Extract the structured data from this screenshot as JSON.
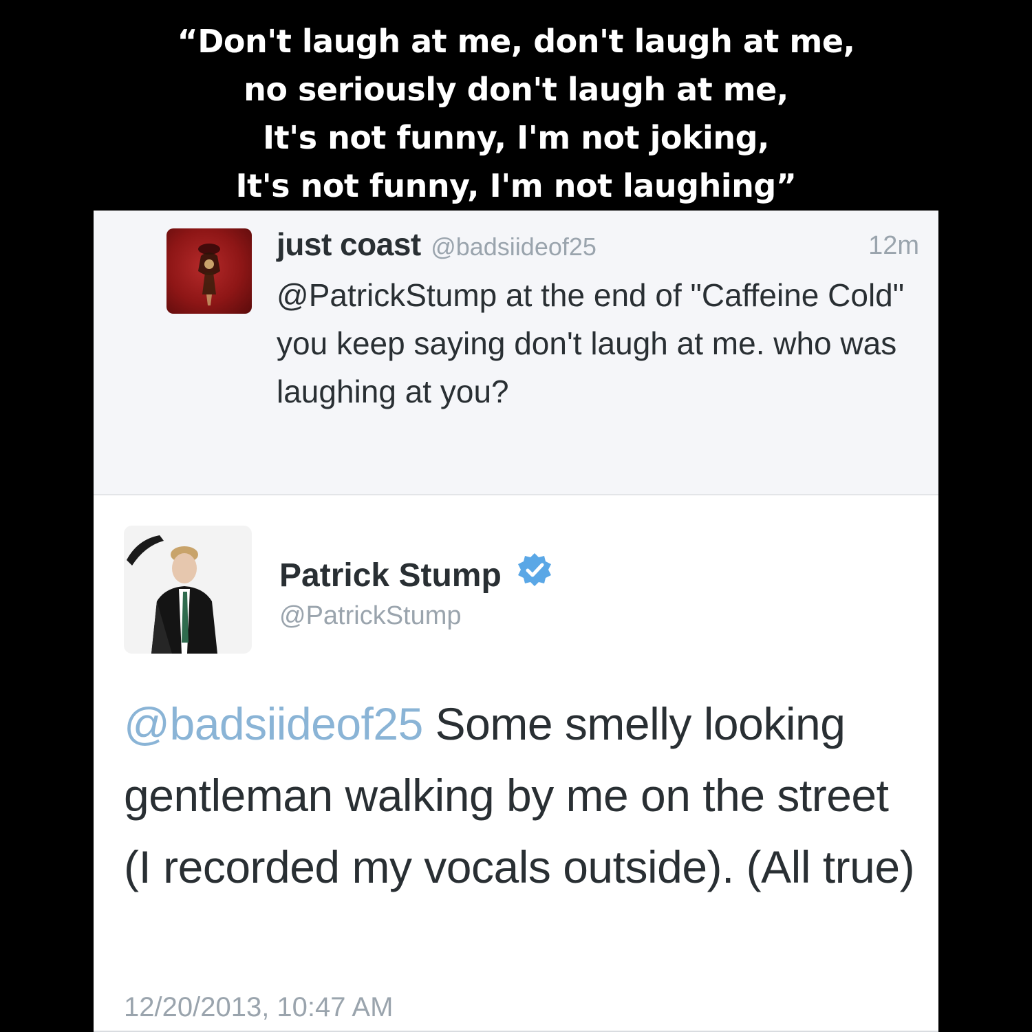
{
  "caption": {
    "lines": [
      "“Don't laugh at me, don't laugh at me,",
      "no seriously don't laugh at me,",
      "It's not funny, I'm not joking,",
      "It's not funny, I'm not laughing”"
    ]
  },
  "reply_tweet": {
    "display_name": "just coast",
    "handle": "@badsiideof25",
    "time_ago": "12m",
    "text": "@PatrickStump at the end of \"Caffeine Cold\" you keep saying don't laugh at me. who was laughing at you?",
    "avatar_icon": "album-art-avatar"
  },
  "main_tweet": {
    "display_name": "Patrick Stump",
    "handle": "@PatrickStump",
    "verified_icon": "verified-badge-icon",
    "mention": "@badsiideof25",
    "text": " Some smelly looking gentleman walking by me on the street (I recorded my vocals outside). (All true)",
    "timestamp": "12/20/2013, 10:47 AM",
    "avatar_icon": "profile-photo-avatar"
  },
  "colors": {
    "banner_bg": "#000000",
    "banner_text": "#ffffff",
    "reply_bg": "#f5f6f9",
    "text_primary": "#292f33",
    "text_secondary": "#9aa4ad",
    "mention": "#8ab4d6",
    "verified": "#5aa7e6"
  }
}
